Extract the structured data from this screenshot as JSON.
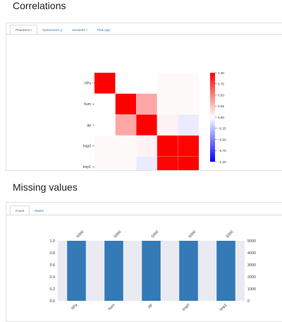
{
  "correlations": {
    "title": "Correlations",
    "tabs": [
      "Pearson's r",
      "Spearman's ρ",
      "Kendall's τ",
      "Phik (φk)"
    ],
    "active_tab": 0
  },
  "missing": {
    "title": "Missing values",
    "tabs": [
      "Count",
      "Matrix"
    ],
    "active_tab": 0
  },
  "colors": {
    "heat_pos": "#ff0000",
    "heat_neg": "#0000ff",
    "bar": "#337ab7",
    "bar_bg": "#eaeaf2"
  },
  "chart_data": [
    {
      "type": "heatmap",
      "variables": [
        "hPa",
        "hum",
        "pp",
        "tmp0",
        "tmp1"
      ],
      "values": [
        [
          1.0,
          0.0,
          0.0,
          0.02,
          0.02
        ],
        [
          0.0,
          1.0,
          0.35,
          0.02,
          0.02
        ],
        [
          0.0,
          0.35,
          1.0,
          0.05,
          -0.08
        ],
        [
          0.02,
          0.02,
          0.05,
          1.0,
          0.99
        ],
        [
          0.02,
          0.02,
          -0.08,
          0.99,
          1.0
        ]
      ],
      "colorbar_ticks": [
        "1.00",
        "0.75",
        "0.50",
        "0.25",
        "0.00",
        "−0.25",
        "−0.50",
        "−0.75",
        "−1.00"
      ],
      "zlim": [
        -1,
        1
      ]
    },
    {
      "type": "bar",
      "categories": [
        "hPa",
        "hum",
        "pp",
        "tmp0",
        "tmp1"
      ],
      "values": [
        5000,
        5000,
        5000,
        5000,
        5000
      ],
      "data_labels": [
        "5000",
        "5000",
        "5000",
        "5000",
        "5000"
      ],
      "left_ticks": [
        "0.0",
        "0.2",
        "0.4",
        "0.6",
        "0.8",
        "1.0"
      ],
      "right_ticks": [
        "0",
        "1000",
        "2000",
        "3000",
        "4000",
        "5000"
      ],
      "ylim": [
        0,
        5000
      ]
    }
  ]
}
